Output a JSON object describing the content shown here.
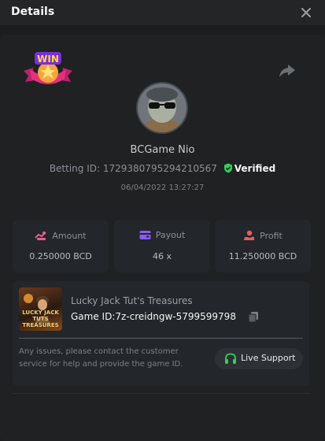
{
  "header": {
    "title": "Details",
    "close_icon": "close-icon"
  },
  "badge": {
    "text": "WIN",
    "icon": "win-star-badge"
  },
  "share_icon": "share-icon",
  "player": {
    "avatar_icon": "user-avatar",
    "name": "BCGame Nio",
    "betting_id_label": "Betting ID:",
    "betting_id": "1729380795294210567",
    "verified_label": "Verified",
    "datetime": "06/04/2022 13:27:27"
  },
  "stats": [
    {
      "label": "Amount",
      "value": "0.250000 BCD",
      "icon": "amount-icon"
    },
    {
      "label": "Payout",
      "value": "46 x",
      "icon": "payout-icon"
    },
    {
      "label": "Profit",
      "value": "11.250000 BCD",
      "icon": "profit-icon"
    }
  ],
  "game": {
    "thumbnail_text": "LUCKY JACK TUTS TREASURES",
    "name": "Lucky Jack Tut's Treasures",
    "id_label": "Game ID:",
    "id": "7z-creidngw-5799599798",
    "notice": "Any issues, please contact the customer service for help and provide the game ID.",
    "support_label": "Live Support"
  },
  "colors": {
    "background": "#1b1d1e",
    "panel": "#1f2123",
    "card": "#23262a",
    "verified_green": "#2fd15a",
    "accent_purple": "#8b5cf6",
    "profit_red": "#ef5a5a",
    "amount_pink": "#ec5b8e",
    "support_green": "#2fd15a"
  }
}
